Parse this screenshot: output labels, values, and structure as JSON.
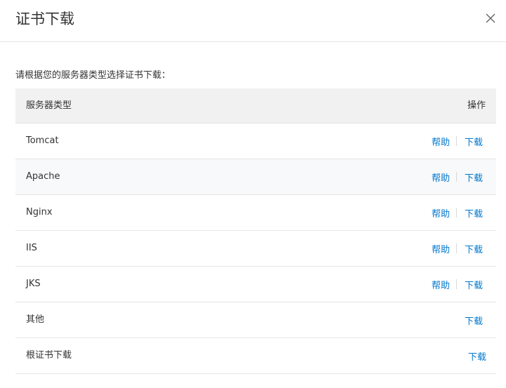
{
  "dialog": {
    "title": "证书下载",
    "close_icon": "close-icon"
  },
  "instruction": "请根据您的服务器类型选择证书下载：",
  "table": {
    "headers": {
      "type": "服务器类型",
      "operation": "操作"
    },
    "rows": [
      {
        "name": "Tomcat",
        "help": "帮助",
        "download": "下载"
      },
      {
        "name": "Apache",
        "help": "帮助",
        "download": "下载"
      },
      {
        "name": "Nginx",
        "help": "帮助",
        "download": "下载"
      },
      {
        "name": "IIS",
        "help": "帮助",
        "download": "下载"
      },
      {
        "name": "JKS",
        "help": "帮助",
        "download": "下载"
      },
      {
        "name": "其他",
        "download": "下载"
      },
      {
        "name": "根证书下载",
        "download": "下载"
      }
    ]
  },
  "colors": {
    "link": "#0077cc",
    "header_bg": "#f1f1f1",
    "row_hover_bg": "#f8f9fa"
  }
}
